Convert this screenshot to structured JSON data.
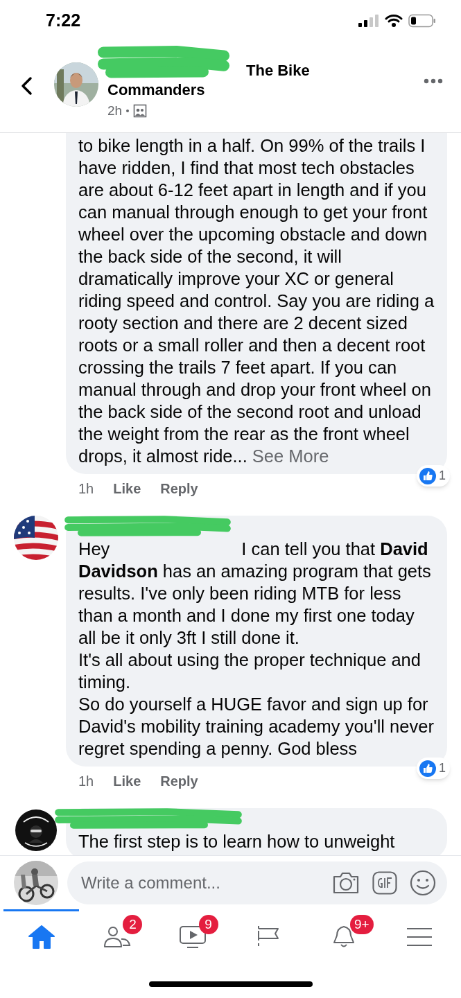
{
  "status_bar": {
    "time": "7:22"
  },
  "post_header": {
    "group_name": "The Bike Commanders",
    "time": "2h"
  },
  "comments": [
    {
      "text": "to bike length in a half. On 99% of the trails I have ridden, I find that most tech obstacles are about 6-12 feet apart in length and if you can manual through enough to get your front wheel over the upcoming obstacle and down the back side of the second, it will dramatically improve your XC or general riding speed and control. Say you are riding a rooty section and there are 2 decent sized roots or a small roller and then a decent root crossing the trails 7 feet apart. If you can manual through and drop your front wheel on the back side of the second root and unload the weight from the rear as the front wheel drops, it almost ride...",
      "see_more": "See More",
      "time": "1h",
      "like": "Like",
      "reply": "Reply",
      "reactions": "1"
    },
    {
      "greeting": "Hey",
      "text": "I can tell you that **David Davidson** has an amazing program that gets results. I've only been riding MTB for less than a month and I done my first one today all be it only 3ft I still done it.\nIt's all about using the proper technique and timing.\nSo do yourself a HUGE favor and sign up for David's mobility training academy you'll never regret spending a penny. God bless",
      "time": "1h",
      "like": "Like",
      "reply": "Reply",
      "reactions": "1"
    },
    {
      "text": "The first step is to learn how to unweight"
    }
  ],
  "composer": {
    "placeholder": "Write a comment..."
  },
  "nav": [
    {
      "kind": "home",
      "selected": true
    },
    {
      "kind": "friends",
      "selected": false,
      "badge": "2"
    },
    {
      "kind": "watch",
      "selected": false,
      "badge": "9"
    },
    {
      "kind": "pages",
      "selected": false
    },
    {
      "kind": "notifications",
      "selected": false,
      "badge": "9+"
    },
    {
      "kind": "menu",
      "selected": false
    }
  ]
}
